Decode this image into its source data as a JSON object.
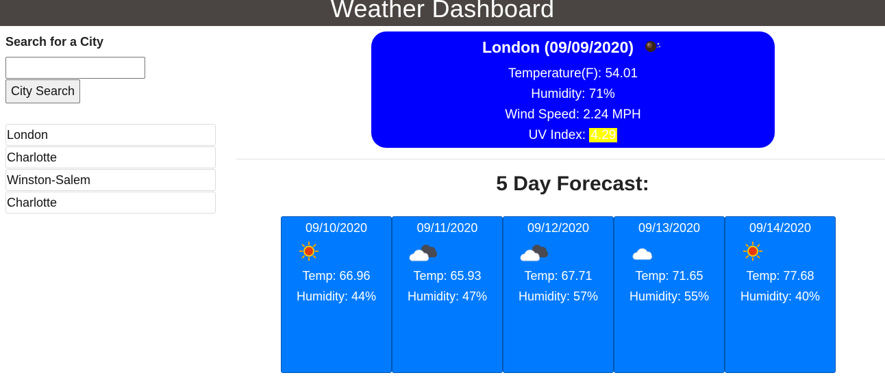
{
  "header": {
    "title": "Weather Dashboard"
  },
  "search": {
    "title": "Search for a City",
    "input_value": "",
    "button_label": "City Search"
  },
  "history": [
    "London",
    "Charlotte",
    "Winston-Salem",
    "Charlotte"
  ],
  "current": {
    "title": "London (09/09/2020)",
    "icon": "night-clear-icon",
    "temperature": "Temperature(F): 54.01",
    "humidity": "Humidity: 71%",
    "wind": "Wind Speed: 2.24 MPH",
    "uv_label": "UV Index: ",
    "uv_value": "4.29",
    "colors": {
      "background": "#0000ff",
      "uv_highlight": "#ffff00"
    }
  },
  "forecast": {
    "title": "5 Day Forecast:",
    "card_color": "#007bff",
    "days": [
      {
        "date": "09/10/2020",
        "icon": "sun-icon",
        "temp": "Temp: 66.96",
        "humidity": "Humidity: 44%"
      },
      {
        "date": "09/11/2020",
        "icon": "broken-clouds-icon",
        "temp": "Temp: 65.93",
        "humidity": "Humidity: 47%"
      },
      {
        "date": "09/12/2020",
        "icon": "broken-clouds-icon",
        "temp": "Temp: 67.71",
        "humidity": "Humidity: 57%"
      },
      {
        "date": "09/13/2020",
        "icon": "cloud-icon",
        "temp": "Temp: 71.65",
        "humidity": "Humidity: 55%"
      },
      {
        "date": "09/14/2020",
        "icon": "sun-icon",
        "temp": "Temp: 77.68",
        "humidity": "Humidity: 40%"
      }
    ]
  }
}
